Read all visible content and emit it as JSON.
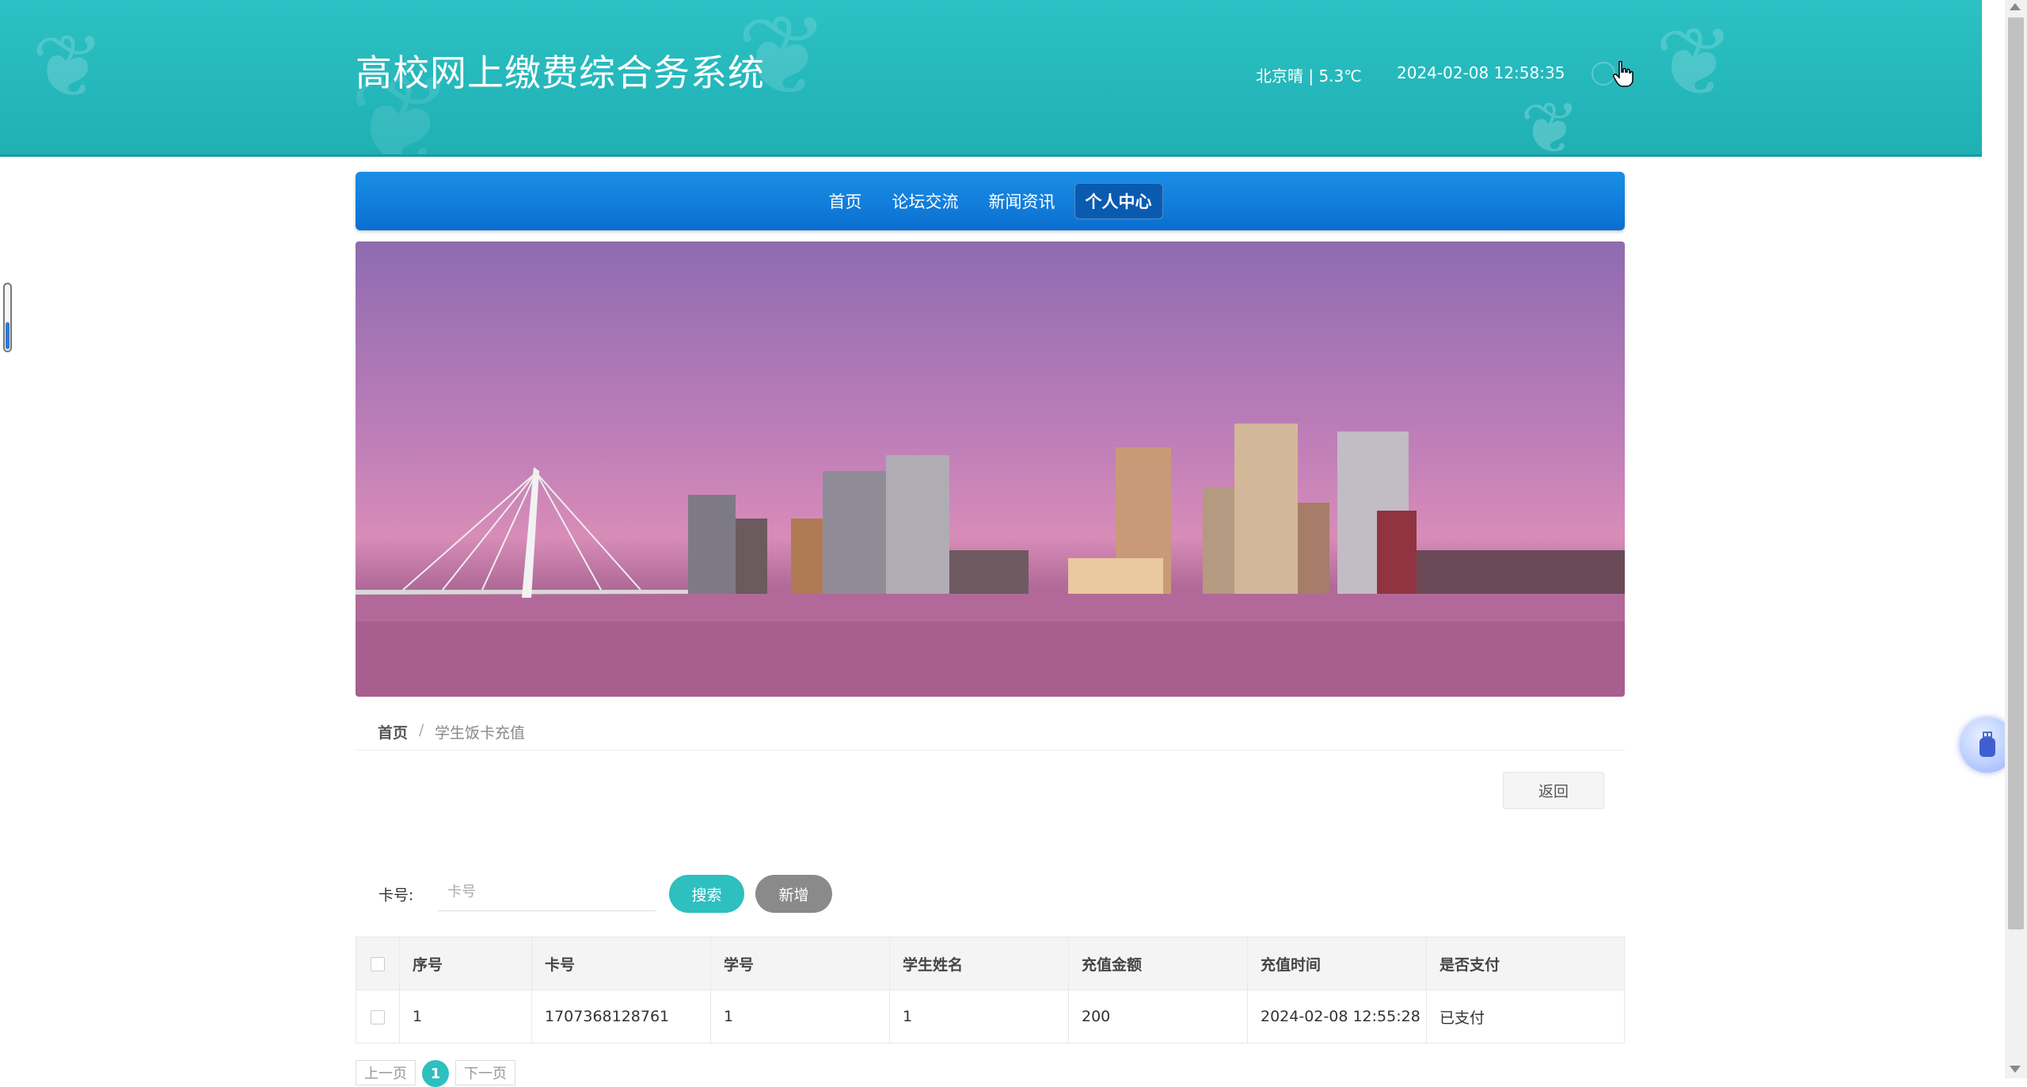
{
  "header": {
    "site_title": "高校网上缴费综合务系统",
    "weather": "北京晴 | 5.3℃",
    "datetime": "2024-02-08   12:58:35"
  },
  "nav": {
    "items": [
      {
        "label": "首页"
      },
      {
        "label": "论坛交流"
      },
      {
        "label": "新闻资讯"
      },
      {
        "label": "个人中心",
        "active": true
      }
    ]
  },
  "breadcrumb": {
    "home": "首页",
    "separator": "/",
    "current": "学生饭卡充值"
  },
  "actions": {
    "back_label": "返回"
  },
  "search": {
    "label": "卡号:",
    "placeholder": "卡号",
    "value": "",
    "search_label": "搜索",
    "add_label": "新增"
  },
  "table": {
    "columns": [
      "序号",
      "卡号",
      "学号",
      "学生姓名",
      "充值金额",
      "充值时间",
      "是否支付"
    ],
    "rows": [
      [
        "1",
        "1707368128761",
        "1",
        "1",
        "200",
        "2024-02-08 12:55:28",
        "已支付"
      ]
    ]
  },
  "pagination": {
    "prev_label": "上一页",
    "current_page": "1",
    "next_label": "下一页"
  },
  "colors": {
    "header_bg": "#2cc1c4",
    "nav_bg": "#0b6fd0",
    "accent_teal": "#2ebfbf",
    "add_button_gray": "#8a8a8a"
  },
  "icons": {
    "user": "user-icon",
    "deco": "butterfly-icon",
    "float": "usb-icon"
  }
}
